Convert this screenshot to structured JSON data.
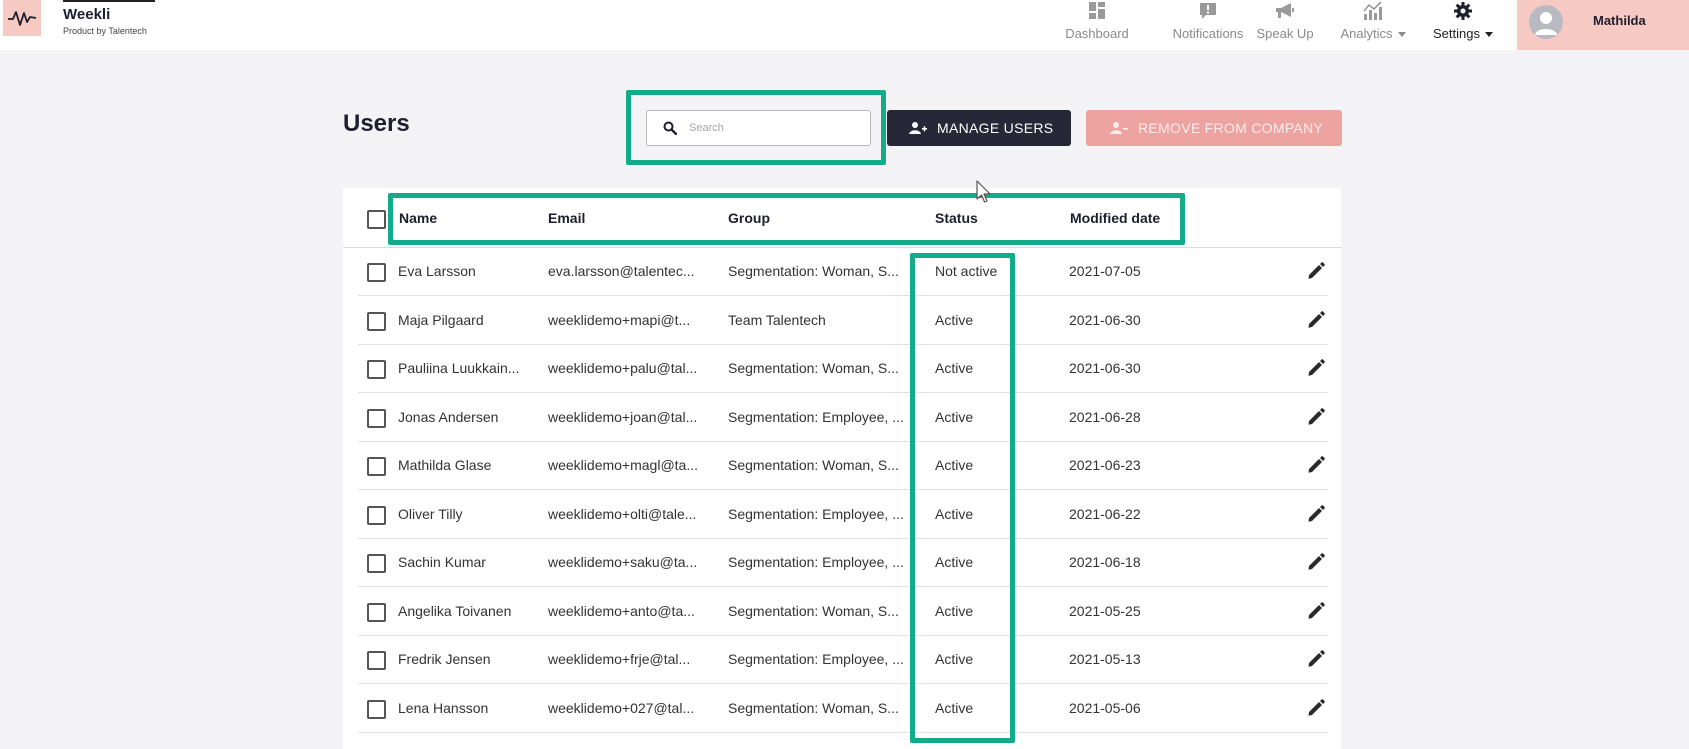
{
  "brand": {
    "name": "Weekli",
    "subtitle": "Product by Talentech"
  },
  "nav": {
    "items": [
      {
        "label": "Dashboard",
        "icon": "dashboard-icon"
      },
      {
        "label": "Notifications",
        "icon": "notification-icon"
      },
      {
        "label": "Speak Up",
        "icon": "megaphone-icon"
      },
      {
        "label": "Analytics",
        "icon": "analytics-icon"
      },
      {
        "label": "Settings",
        "icon": "gear-icon"
      }
    ]
  },
  "user": {
    "name": "Mathilda"
  },
  "page": {
    "title": "Users"
  },
  "search": {
    "placeholder": "Search",
    "value": ""
  },
  "actions": {
    "manage_label": "MANAGE USERS",
    "remove_label": "REMOVE FROM COMPANY"
  },
  "table": {
    "headers": {
      "name": "Name",
      "email": "Email",
      "group": "Group",
      "status": "Status",
      "modified": "Modified date"
    },
    "rows": [
      {
        "name": "Eva Larsson",
        "email": "eva.larsson@talentec...",
        "group": "Segmentation: Woman, S...",
        "status": "Not active",
        "modified": "2021-07-05"
      },
      {
        "name": "Maja Pilgaard",
        "email": "weeklidemo+mapi@t...",
        "group": "Team Talentech",
        "status": "Active",
        "modified": "2021-06-30"
      },
      {
        "name": "Pauliina Luukkain...",
        "email": "weeklidemo+palu@tal...",
        "group": "Segmentation: Woman, S...",
        "status": "Active",
        "modified": "2021-06-30"
      },
      {
        "name": "Jonas Andersen",
        "email": "weeklidemo+joan@tal...",
        "group": "Segmentation: Employee, ...",
        "status": "Active",
        "modified": "2021-06-28"
      },
      {
        "name": "Mathilda Glase",
        "email": "weeklidemo+magl@ta...",
        "group": "Segmentation: Woman, S...",
        "status": "Active",
        "modified": "2021-06-23"
      },
      {
        "name": "Oliver Tilly",
        "email": "weeklidemo+olti@tale...",
        "group": "Segmentation: Employee, ...",
        "status": "Active",
        "modified": "2021-06-22"
      },
      {
        "name": "Sachin Kumar",
        "email": "weeklidemo+saku@ta...",
        "group": "Segmentation: Employee, ...",
        "status": "Active",
        "modified": "2021-06-18"
      },
      {
        "name": "Angelika Toivanen",
        "email": "weeklidemo+anto@ta...",
        "group": "Segmentation: Woman, S...",
        "status": "Active",
        "modified": "2021-05-25"
      },
      {
        "name": "Fredrik Jensen",
        "email": "weeklidemo+frje@tal...",
        "group": "Segmentation: Employee, ...",
        "status": "Active",
        "modified": "2021-05-13"
      },
      {
        "name": "Lena Hansson",
        "email": "weeklidemo+027@tal...",
        "group": "Segmentation: Woman, S...",
        "status": "Active",
        "modified": "2021-05-06"
      }
    ]
  },
  "colors": {
    "accent_highlight": "#13ac8b",
    "brand_pink": "#f6c9c3",
    "button_dark": "#262838",
    "button_remove": "#eda4a0"
  }
}
